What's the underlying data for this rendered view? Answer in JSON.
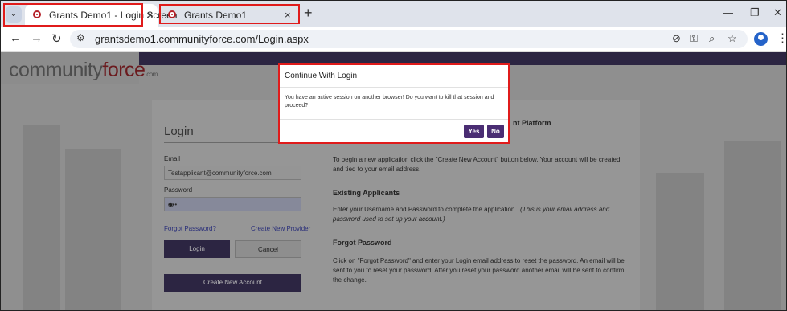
{
  "browser": {
    "tabs": [
      {
        "title": "Grants Demo1 - Login Screen",
        "close": "×"
      },
      {
        "title": "Grants Demo1",
        "close": "×"
      }
    ],
    "tab_menu": "⌄",
    "new_tab": "+",
    "window_controls": {
      "minimize": "—",
      "restore": "❐",
      "close": "✕"
    },
    "nav": {
      "back": "←",
      "forward": "→",
      "reload": "↻"
    },
    "url": "grantsdemo1.communityforce.com/Login.aspx",
    "omnibox_icons": {
      "site_info": "⚙",
      "eye_off": "⊘",
      "key": "⚿",
      "zoom": "⌕",
      "star": "☆"
    },
    "menu": "⋮"
  },
  "brand": {
    "part1": "community",
    "part2": "force",
    "suffix": ".com"
  },
  "login": {
    "title": "Login",
    "email_label": "Email",
    "email_value": "Testapplicant@communityforce.com",
    "password_label": "Password",
    "password_value": "••••",
    "eye": "◉",
    "forgot_link": "Forgot Password?",
    "create_provider_link": "Create New Provider",
    "login_button": "Login",
    "cancel_button": "Cancel",
    "create_account_button": "Create New Account"
  },
  "info": {
    "platform_heading": "nt Platform",
    "new_text": "To begin a new application click the \"Create New Account\" button below. Your account will be created and tied to your email address.",
    "existing_heading": "Existing Applicants",
    "existing_text": "Enter your Username and Password to complete the application.",
    "existing_note": "(This is your email address and password used to set up your account.)",
    "forgot_heading": "Forgot Password",
    "forgot_text": "Click on \"Forgot Password\" and enter your Login email address to reset the password.  An email will be sent to you to reset your password. After you reset your password another email will be sent to confirm the change."
  },
  "modal": {
    "title": "Continue With Login",
    "message": "You have an active session on another browser! Do you want to kill that session and proceed?",
    "yes": "Yes",
    "no": "No"
  },
  "colors": {
    "highlight": "#e01b1b",
    "brand_purple": "#4a2d73",
    "brand_red": "#6b1a1e"
  }
}
